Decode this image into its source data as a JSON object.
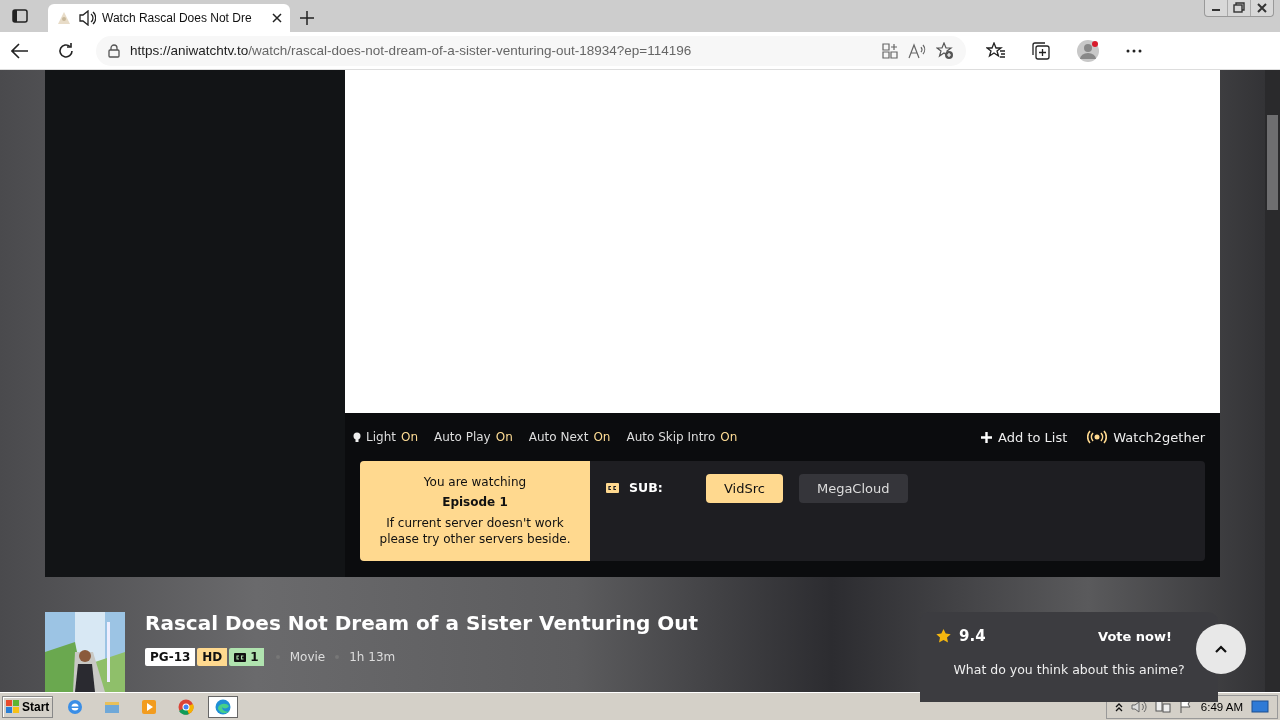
{
  "browser": {
    "tab_title": "Watch Rascal Does Not Dre",
    "url_host": "https://aniwatchtv.to",
    "url_path": "/watch/rascal-does-not-dream-of-a-sister-venturing-out-18934?ep=114196"
  },
  "player": {
    "toggles": [
      {
        "label": "Light",
        "state": "On",
        "kind": "light"
      },
      {
        "label": "Auto Play",
        "state": "On"
      },
      {
        "label": "Auto Next",
        "state": "On"
      },
      {
        "label": "Auto Skip Intro",
        "state": "On"
      }
    ],
    "actions": [
      {
        "label": "Add to List",
        "kind": "add"
      },
      {
        "label": "Watch2gether",
        "kind": "broadcast"
      }
    ],
    "notice": {
      "line1": "You are watching",
      "episode": "Episode 1",
      "hint": "If current server doesn't work please try other servers beside."
    },
    "sub_label": "SUB:",
    "servers": [
      {
        "name": "VidSrc",
        "selected": true
      },
      {
        "name": "MegaCloud",
        "selected": false
      }
    ]
  },
  "anime": {
    "title": "Rascal Does Not Dream of a Sister Venturing Out",
    "rating": "PG-13",
    "quality": "HD",
    "subs": "1",
    "type": "Movie",
    "duration": "1h 13m"
  },
  "vote": {
    "score": "9.4",
    "button": "Vote now!",
    "prompt": "What do you think about this anime?"
  },
  "taskbar": {
    "start": "Start",
    "apps": [
      {
        "kind": "ie",
        "selected": false
      },
      {
        "kind": "folder",
        "selected": false
      },
      {
        "kind": "media",
        "selected": false
      },
      {
        "kind": "chrome",
        "selected": false
      },
      {
        "kind": "edge",
        "selected": true
      }
    ],
    "clock": "6:49 AM"
  }
}
